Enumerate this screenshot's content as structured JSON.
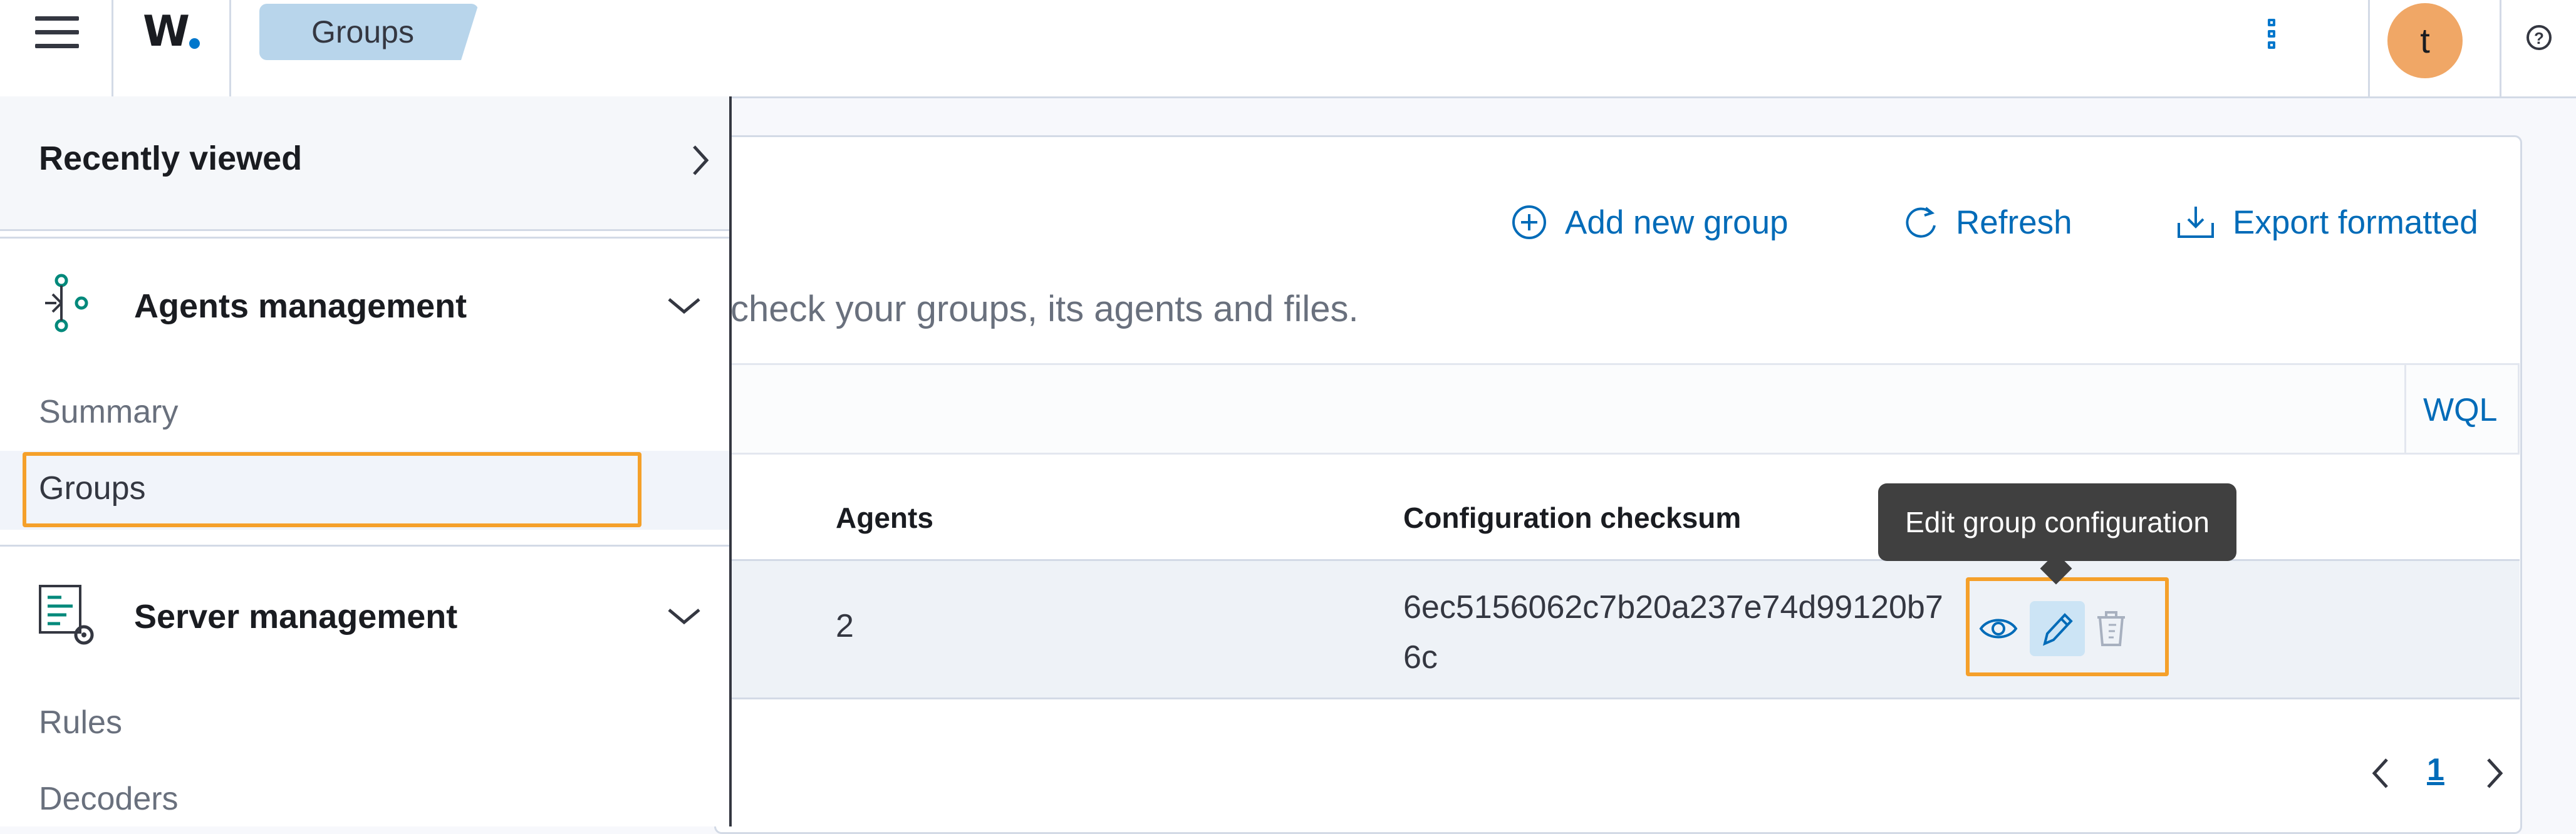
{
  "header": {
    "logo": "W",
    "breadcrumb": "Groups",
    "avatar_initial": "t",
    "help_icon": "?"
  },
  "page": {
    "actions": {
      "add": "Add new group",
      "refresh": "Refresh",
      "export": "Export formatted"
    },
    "description": "check your groups, its agents and files.",
    "search": {
      "wql_label": "WQL"
    },
    "table": {
      "headers": {
        "agents": "Agents",
        "checksum": "Configuration checksum"
      },
      "rows": [
        {
          "agents": "2",
          "checksum": "6ec5156062c7b20a237e74d99120b76c"
        }
      ]
    },
    "tooltip": "Edit group configuration",
    "pagination": {
      "current_page": "1"
    }
  },
  "sidebar": {
    "recently_viewed": "Recently viewed",
    "sections": [
      {
        "label": "Agents management",
        "items": [
          "Summary",
          "Groups"
        ]
      },
      {
        "label": "Server management",
        "items": [
          "Rules",
          "Decoders"
        ]
      }
    ]
  },
  "colors": {
    "accent": "#006bb8",
    "highlight": "#f5a02a",
    "avatar": "#f0a766",
    "icon_teal": "#00897b"
  }
}
